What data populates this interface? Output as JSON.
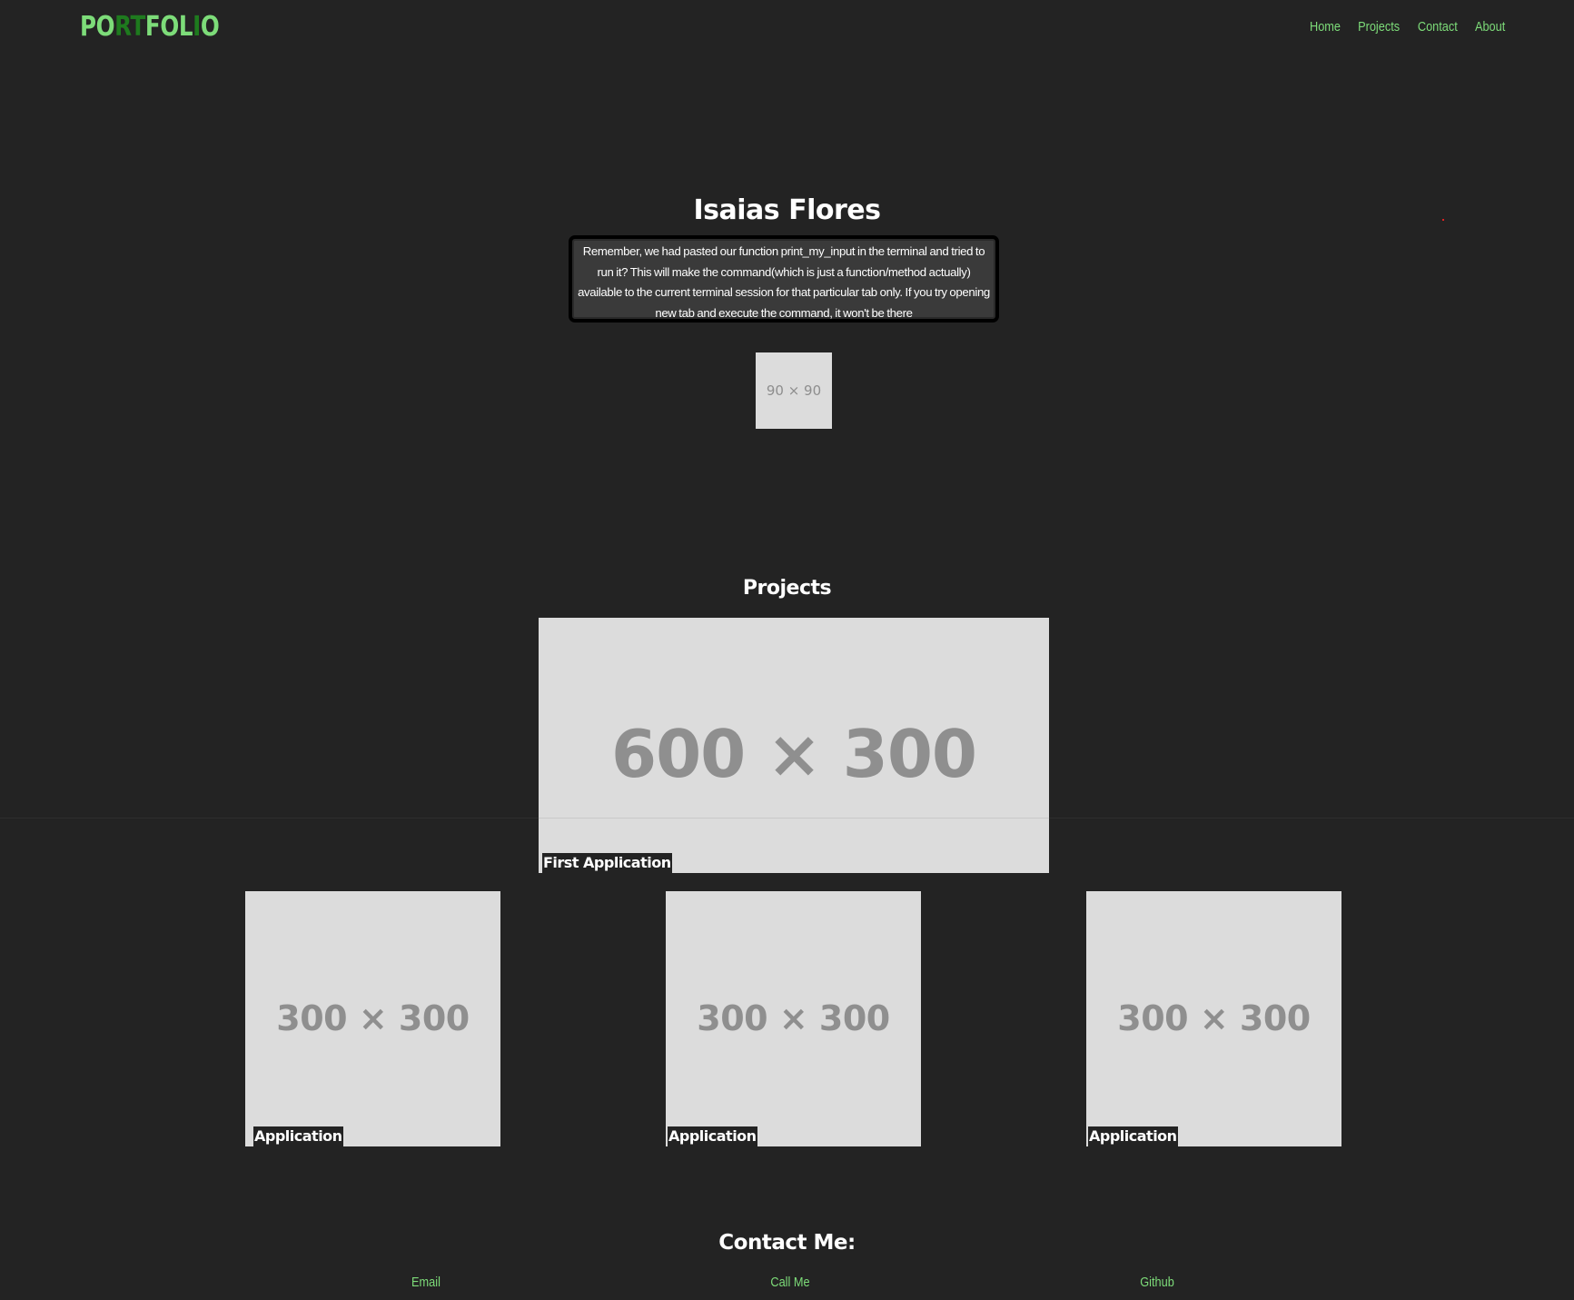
{
  "header": {
    "logo": [
      {
        "text": "PO",
        "tone": "light"
      },
      {
        "text": "RT",
        "tone": "dark"
      },
      {
        "text": "FO",
        "tone": "light"
      },
      {
        "text": "L",
        "tone": "light"
      },
      {
        "text": "I",
        "tone": "dark"
      },
      {
        "text": "O",
        "tone": "light"
      }
    ],
    "nav": [
      {
        "label": "Home"
      },
      {
        "label": "Projects"
      },
      {
        "label": "Contact"
      },
      {
        "label": "About"
      }
    ]
  },
  "hero": {
    "name": "Isaias Flores",
    "bio": "Remember, we had pasted our function print_my_input in the terminal and tried to run it? This will make the command(which is just a function/method actually) available to the current terminal session for that particular tab only. If you try opening new tab and execute the command, it won't be there",
    "avatar_placeholder": "90 × 90"
  },
  "projects": {
    "title": "Projects",
    "featured": {
      "placeholder": "600 × 300",
      "caption": "First Application"
    },
    "items": [
      {
        "placeholder": "300 × 300",
        "caption": "Application"
      },
      {
        "placeholder": "300 × 300",
        "caption": "Application"
      },
      {
        "placeholder": "300 × 300",
        "caption": "Application"
      }
    ]
  },
  "contact": {
    "title": "Contact Me:",
    "links": [
      {
        "label": "Email"
      },
      {
        "label": "Call Me"
      },
      {
        "label": "Github"
      }
    ]
  },
  "colors": {
    "background": "#232323",
    "accent": "#7ddc79",
    "accent_dark": "#1e7a1e",
    "placeholder_bg": "#dcdcdc",
    "placeholder_text": "#8f8f8f"
  }
}
